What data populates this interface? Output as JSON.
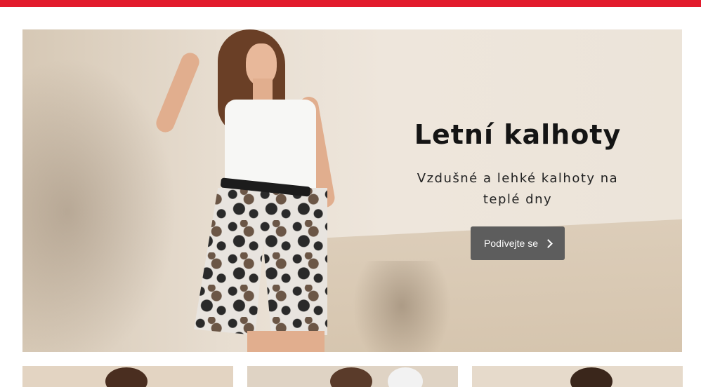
{
  "topbar": {
    "color": "#e21b2c"
  },
  "hero": {
    "title": "Letní kalhoty",
    "subtitle_line1": "Vzdušné a lehké kalhoty na",
    "subtitle_line2": "teplé dny",
    "cta_label": "Podívejte se",
    "cta_icon": "chevron-right-icon"
  },
  "cards": [
    {
      "name": "category-card-1"
    },
    {
      "name": "category-card-2"
    },
    {
      "name": "category-card-3"
    }
  ]
}
